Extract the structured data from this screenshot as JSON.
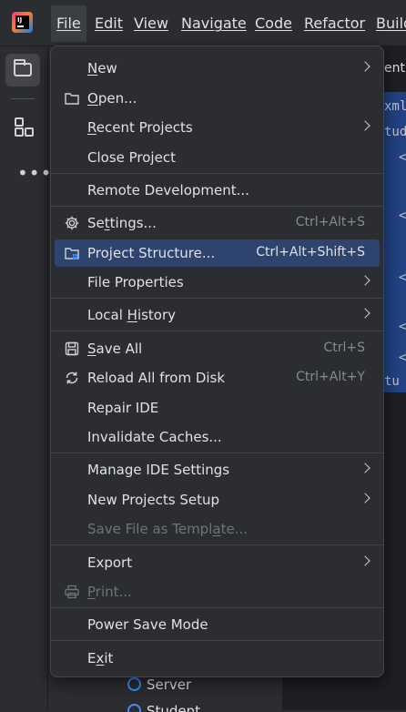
{
  "menubar": {
    "items": [
      {
        "label": "File"
      },
      {
        "label": "Edit"
      },
      {
        "label": "View"
      },
      {
        "label": "Navigate"
      },
      {
        "label": "Code"
      },
      {
        "label": "Refactor"
      },
      {
        "label": "Build"
      }
    ]
  },
  "toolstrip": {
    "items": [
      {
        "name": "project",
        "icon": "folder-icon"
      },
      {
        "name": "structure",
        "icon": "structure-icon"
      },
      {
        "name": "more",
        "icon": "more-icon"
      }
    ]
  },
  "editor": {
    "tab_label": "ent.",
    "code_lines": [
      "xml",
      "tud",
      "<",
      "<",
      "<",
      "<",
      "<",
      "tu"
    ]
  },
  "project_tree": {
    "server_label": "Server",
    "student_label": "Student"
  },
  "file_menu": {
    "items": {
      "new": {
        "label": "New",
        "mnemonic": "N",
        "rest": "ew",
        "submenu": true
      },
      "open": {
        "label": "Open...",
        "mnemonic": "O",
        "rest": "pen...",
        "icon": "folder-icon"
      },
      "recent_projects": {
        "label": "Recent Projects",
        "mnemonic": "R",
        "rest": "ecent Projects",
        "submenu": true
      },
      "close_project": {
        "label": "Close Project"
      },
      "remote_development": {
        "label": "Remote Development..."
      },
      "settings": {
        "label": "Settings...",
        "pre": "Se",
        "mnemonic": "t",
        "rest": "tings...",
        "shortcut": "Ctrl+Alt+S",
        "icon": "gear-icon"
      },
      "project_structure": {
        "label": "Project Structure...",
        "shortcut": "Ctrl+Alt+Shift+S",
        "icon": "project-structure-icon"
      },
      "file_properties": {
        "label": "File Properties",
        "submenu": true
      },
      "local_history": {
        "label": "Local History",
        "pre": "Local ",
        "mnemonic": "H",
        "rest": "istory",
        "submenu": true
      },
      "save_all": {
        "label": "Save All",
        "mnemonic": "S",
        "rest": "ave All",
        "shortcut": "Ctrl+S",
        "icon": "save-icon"
      },
      "reload_all": {
        "label": "Reload All from Disk",
        "shortcut": "Ctrl+Alt+Y",
        "icon": "reload-icon"
      },
      "repair_ide": {
        "label": "Repair IDE"
      },
      "invalidate_caches": {
        "label": "Invalidate Caches..."
      },
      "manage_ide_settings": {
        "label": "Manage IDE Settings",
        "submenu": true
      },
      "new_projects_setup": {
        "label": "New Projects Setup",
        "submenu": true
      },
      "save_file_as_template": {
        "label": "Save File as Template...",
        "pre": "Save File as Templ",
        "mnemonic": "a",
        "rest": "te...",
        "disabled": true
      },
      "export": {
        "label": "Export",
        "submenu": true
      },
      "print": {
        "label": "Print...",
        "mnemonic": "P",
        "rest": "rint...",
        "disabled": true,
        "icon": "printer-icon"
      },
      "power_save_mode": {
        "label": "Power Save Mode"
      },
      "exit": {
        "label": "Exit",
        "pre": "E",
        "mnemonic": "x",
        "rest": "it"
      }
    }
  },
  "colors": {
    "menu_bg": "#2b2d30",
    "selection": "#2e436e",
    "text": "#dfe1e5",
    "shortcut_text": "#868a91",
    "disabled_text": "#6f737a",
    "editor_selection": "#214283"
  }
}
